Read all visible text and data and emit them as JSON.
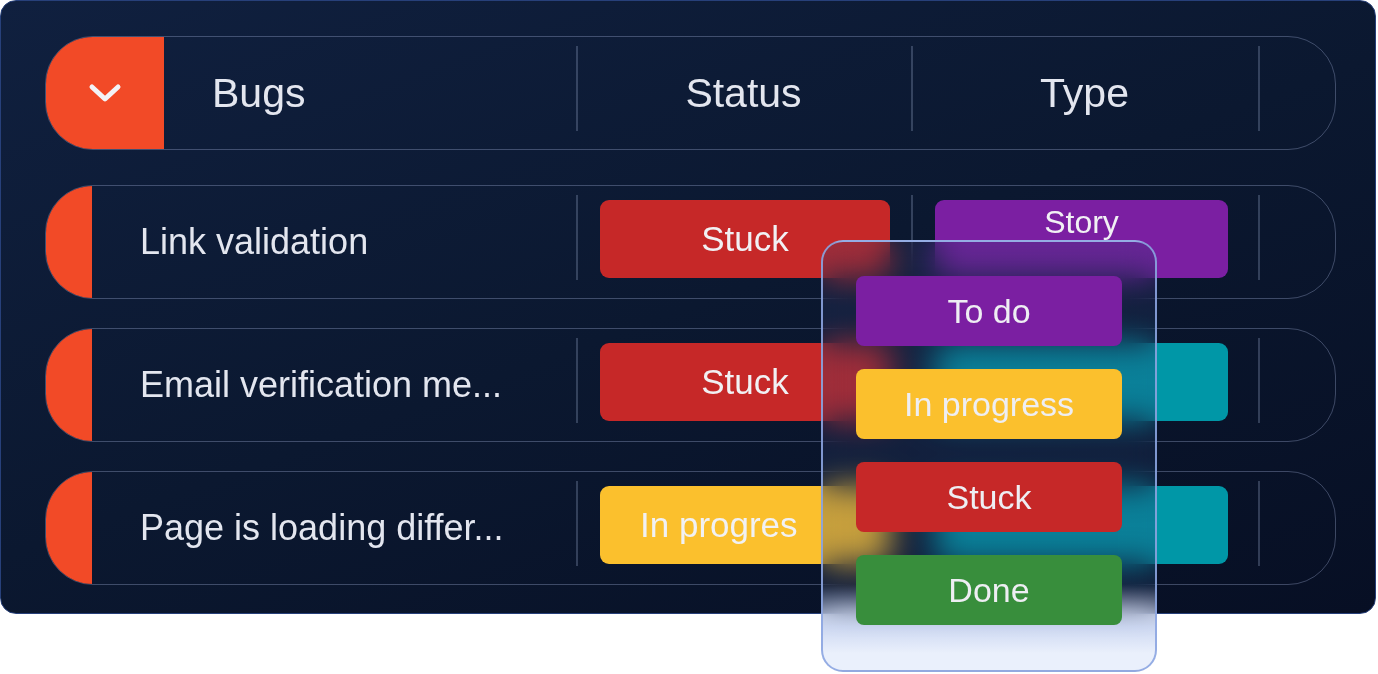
{
  "header": {
    "columns": [
      "Bugs",
      "Status",
      "Type"
    ]
  },
  "rows": [
    {
      "name": "Link validation",
      "status": {
        "label": "Stuck",
        "color": "#c62828"
      },
      "type": {
        "label": "Story",
        "color": "#7b1fa2"
      }
    },
    {
      "name": "Email verification me...",
      "status": {
        "label": "Stuck",
        "color": "#c62828"
      },
      "type": {
        "color": "#0097a7"
      }
    },
    {
      "name": "Page is loading differ...",
      "status": {
        "label": "In progres",
        "color": "#fbc02d"
      },
      "type": {
        "color": "#0097a7"
      }
    }
  ],
  "dropdown": {
    "options": [
      {
        "label": "To do",
        "color": "#7b1fa2"
      },
      {
        "label": "In progress",
        "color": "#fbc02d"
      },
      {
        "label": "Stuck",
        "color": "#c62828"
      },
      {
        "label": "Done",
        "color": "#388e3c"
      }
    ]
  }
}
